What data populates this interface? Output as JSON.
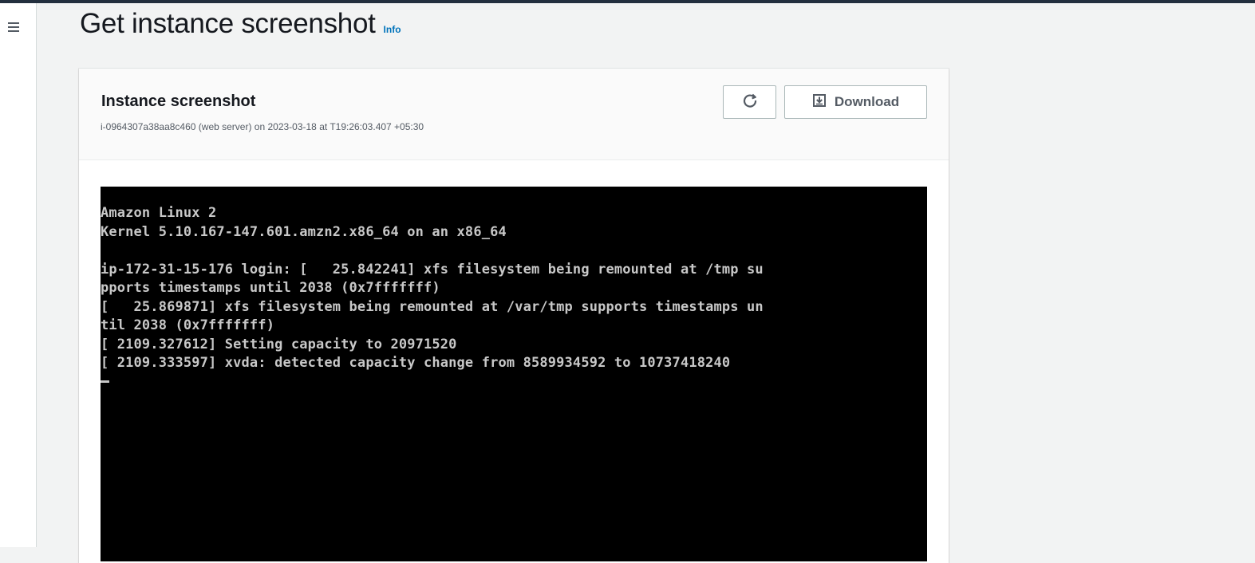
{
  "header": {
    "title": "Get instance screenshot",
    "info_label": "Info"
  },
  "card": {
    "title": "Instance screenshot",
    "subtitle": "i-0964307a38aa8c460 (web server) on 2023-03-18 at T19:26:03.407 +05:30",
    "refresh_icon": "refresh-icon",
    "download_icon": "download-icon",
    "download_label": "Download"
  },
  "terminal": {
    "lines": [
      "Amazon Linux 2",
      "Kernel 5.10.167-147.601.amzn2.x86_64 on an x86_64",
      "",
      "ip-172-31-15-176 login: [   25.842241] xfs filesystem being remounted at /tmp su",
      "pports timestamps until 2038 (0x7fffffff)",
      "[   25.869871] xfs filesystem being remounted at /var/tmp supports timestamps un",
      "til 2038 (0x7fffffff)",
      "[ 2109.327612] Setting capacity to 20971520",
      "[ 2109.333597] xvda: detected capacity change from 8589934592 to 10737418240"
    ]
  },
  "nav": {
    "menu_icon": "hamburger-menu-icon"
  },
  "colors": {
    "topbar": "#232f3e",
    "background": "#f2f3f3",
    "link": "#0073bb",
    "terminal_bg": "#000000",
    "terminal_fg": "#c8c8c8"
  }
}
